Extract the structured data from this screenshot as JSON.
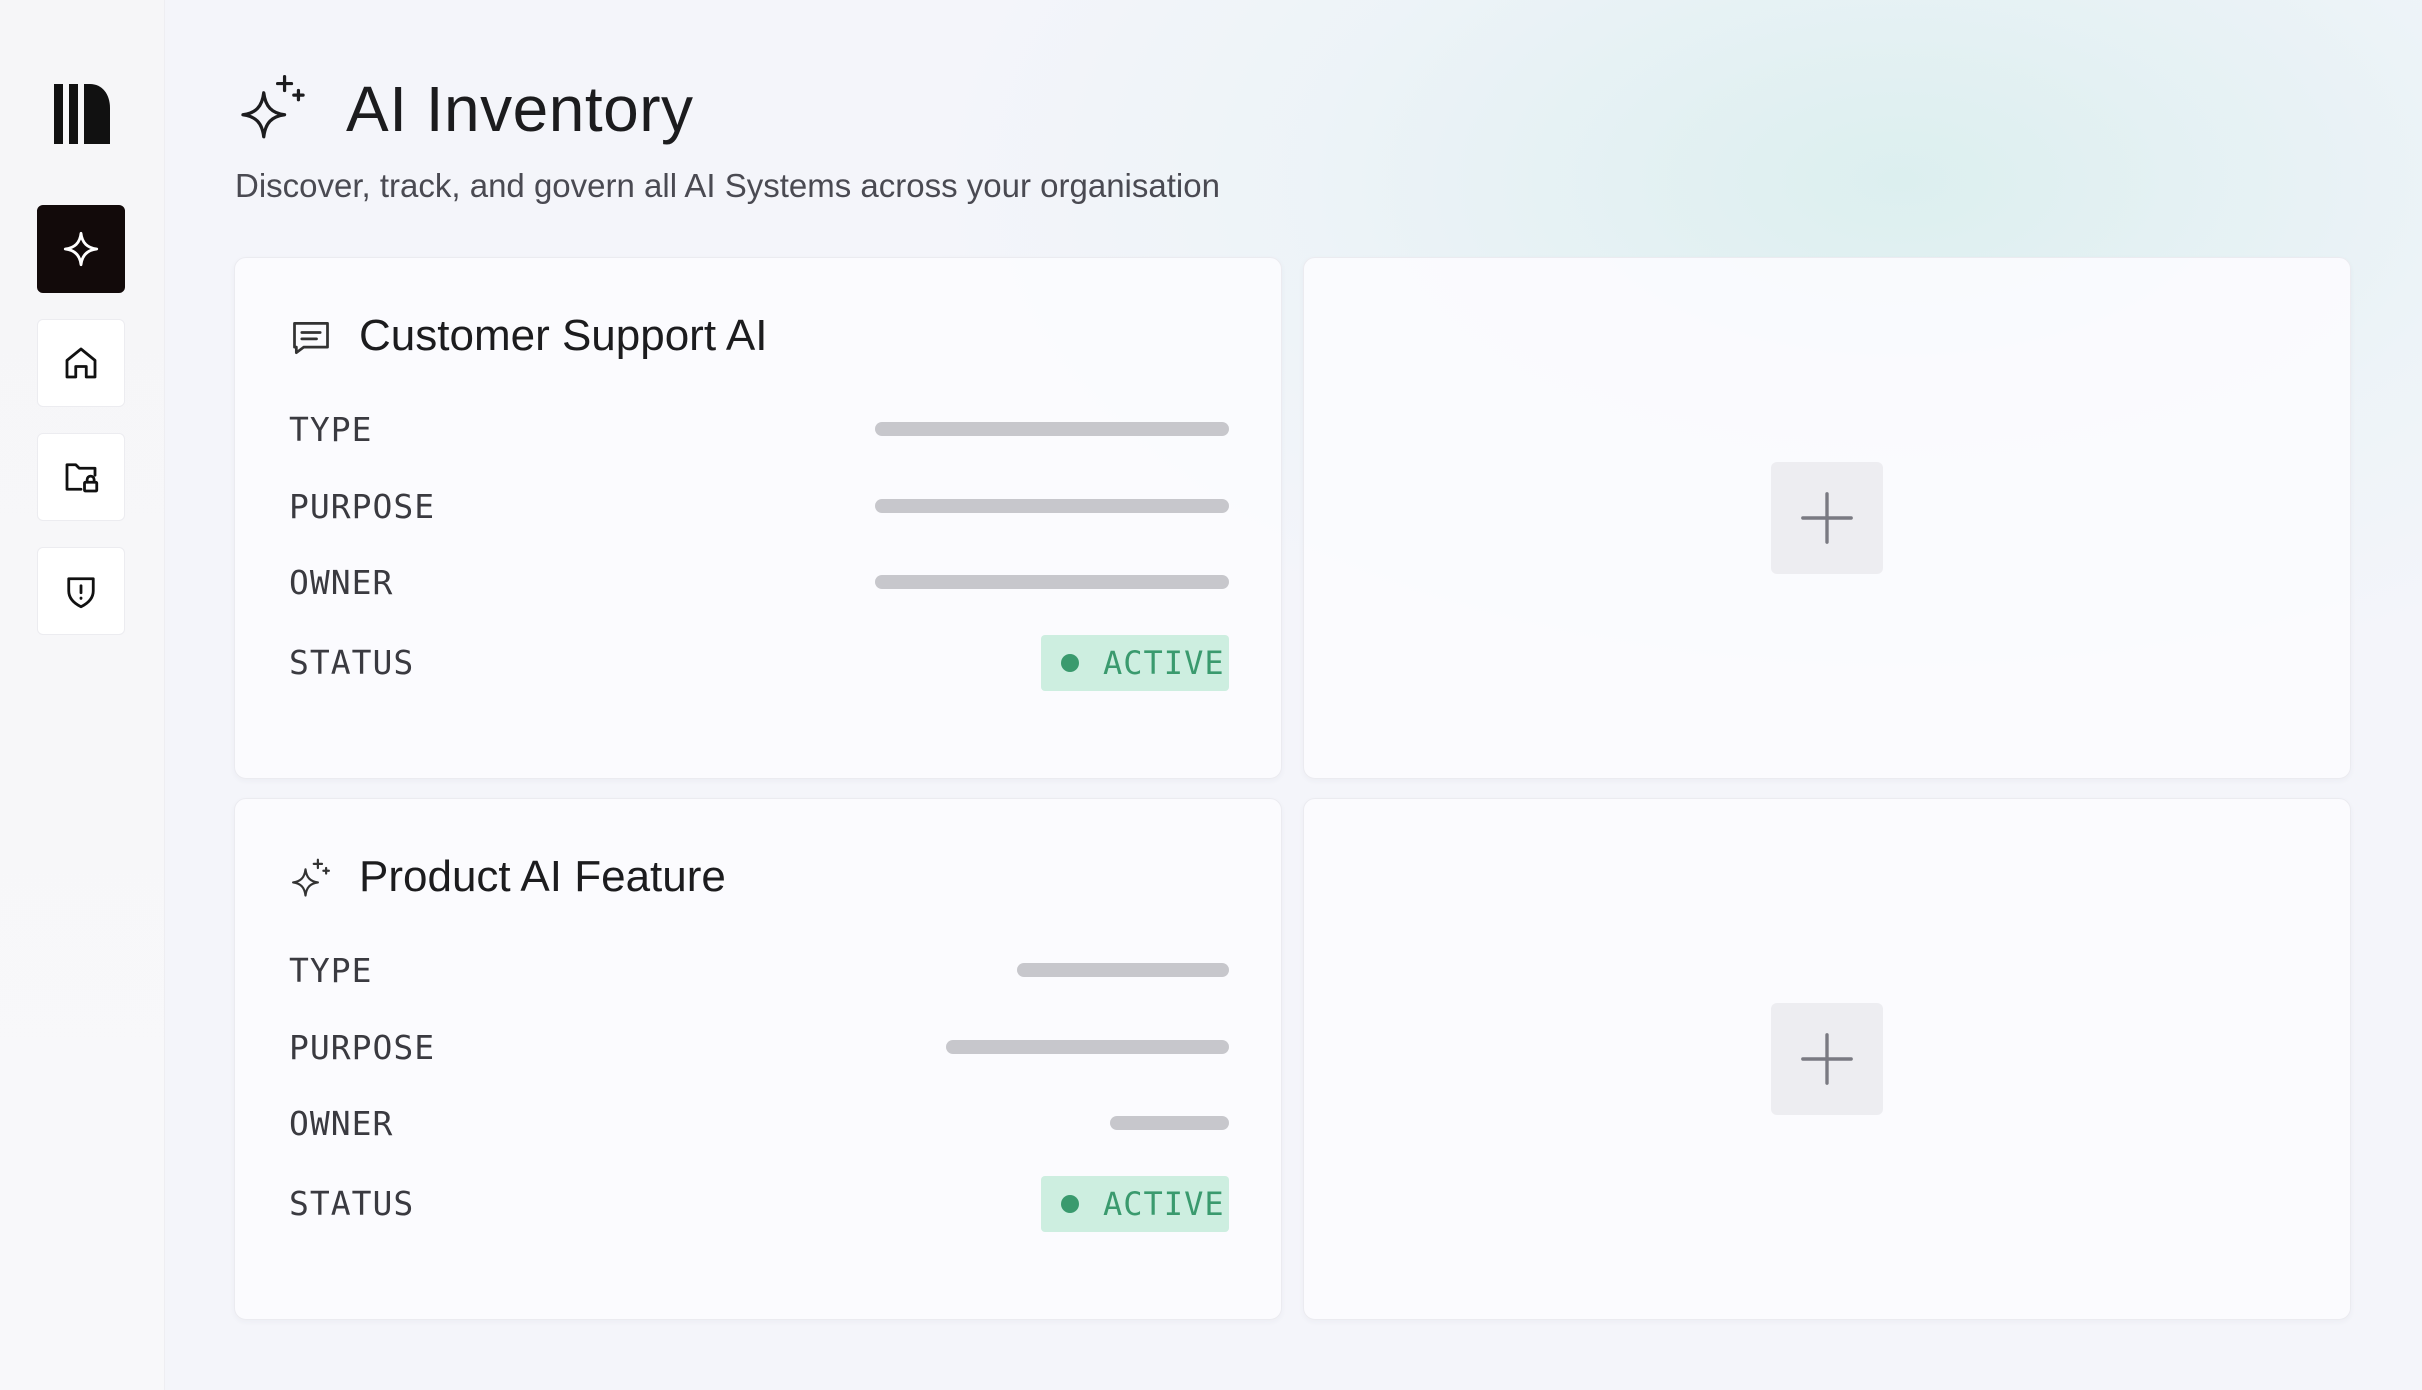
{
  "page": {
    "title": "AI Inventory",
    "subtitle": "Discover, track, and govern all AI Systems across your organisation"
  },
  "sidebar": {
    "logo": "library-logo-icon",
    "items": [
      {
        "icon": "sparkle-icon",
        "active": true
      },
      {
        "icon": "home-icon",
        "active": false
      },
      {
        "icon": "folder-lock-icon",
        "active": false
      },
      {
        "icon": "shield-alert-icon",
        "active": false
      }
    ]
  },
  "cards": [
    {
      "title": "Customer Support AI",
      "icon": "message-square-icon",
      "rows": [
        {
          "label": "TYPE"
        },
        {
          "label": "PURPOSE"
        },
        {
          "label": "OWNER"
        }
      ],
      "status_label": "STATUS",
      "status_value": "ACTIVE"
    },
    {
      "title": "Product AI Feature",
      "icon": "sparkles-icon",
      "rows": [
        {
          "label": "TYPE"
        },
        {
          "label": "PURPOSE"
        },
        {
          "label": "OWNER"
        }
      ],
      "status_label": "STATUS",
      "status_value": "ACTIVE"
    }
  ],
  "add_cards": [
    {
      "icon": "plus-icon"
    },
    {
      "icon": "plus-icon"
    }
  ],
  "colors": {
    "active_badge_bg": "#cdeee0",
    "active_badge_text": "#3a9a6e",
    "nav_active_bg": "#120a0a"
  }
}
